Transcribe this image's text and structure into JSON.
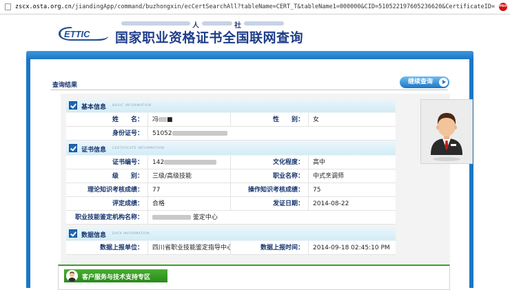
{
  "browser": {
    "url_domain": "zscx.osta.org.cn",
    "url_path": "/jiandingApp/command/buzhongxin/ecCertSearchAll?tableName=CERT_T&tableName1=000000&CID=510522197605236620&CertificateID="
  },
  "header": {
    "logo_text": "ETTIC",
    "top_char_1": "人",
    "top_char_2": "社",
    "site_title": "国家职业资格证书全国联网查询"
  },
  "main": {
    "result_title": "查询结果",
    "continue_label": "继续查询"
  },
  "sections": {
    "basic": {
      "title": "基本信息",
      "subtitle": "BASIC INFORMATION"
    },
    "cert": {
      "title": "证书信息",
      "subtitle": "CERTIFICATE INFORMATION"
    },
    "data": {
      "title": "数据信息",
      "subtitle": "DATA INFORMATION"
    }
  },
  "basic": {
    "name_label": "姓　　名：",
    "name_value": "冯",
    "gender_label": "性　　别：",
    "gender_value": "女",
    "id_label": "身份证号：",
    "id_value": "51052"
  },
  "cert": {
    "number_label": "证书编号：",
    "number_value": "142",
    "education_label": "文化程度：",
    "education_value": "高中",
    "level_label": "级　　别：",
    "level_value": "三级/高级技能",
    "occupation_label": "职业名称：",
    "occupation_value": "中式烹调师",
    "theory_label": "理论知识考核成绩：",
    "theory_value": "77",
    "operation_label": "操作知识考核成绩：",
    "operation_value": "75",
    "eval_label": "评定成绩：",
    "eval_value": "合格",
    "issue_label": "发证日期：",
    "issue_value": "2014-08-22",
    "agency_label": "职业技能鉴定机构名称：",
    "agency_value": "鉴定中心"
  },
  "data": {
    "unit_label": "数据上报单位：",
    "unit_value": "四川省职业技能鉴定指导中心",
    "time_label": "数据上报时间：",
    "time_value": "2014-09-18 02:45:10 PM"
  },
  "support": {
    "title": "客户服务与技术支持专区"
  },
  "colors": {
    "frame_blue": "#1b77c4",
    "title_navy": "#1f3d8a",
    "label_navy": "#16356f",
    "support_green": "#3aa02b"
  },
  "icons": {
    "page": "page-icon",
    "extension": "pro-icon",
    "check": "check-icon",
    "avatar": "person-icon",
    "arrow": "arrow-right-icon"
  }
}
